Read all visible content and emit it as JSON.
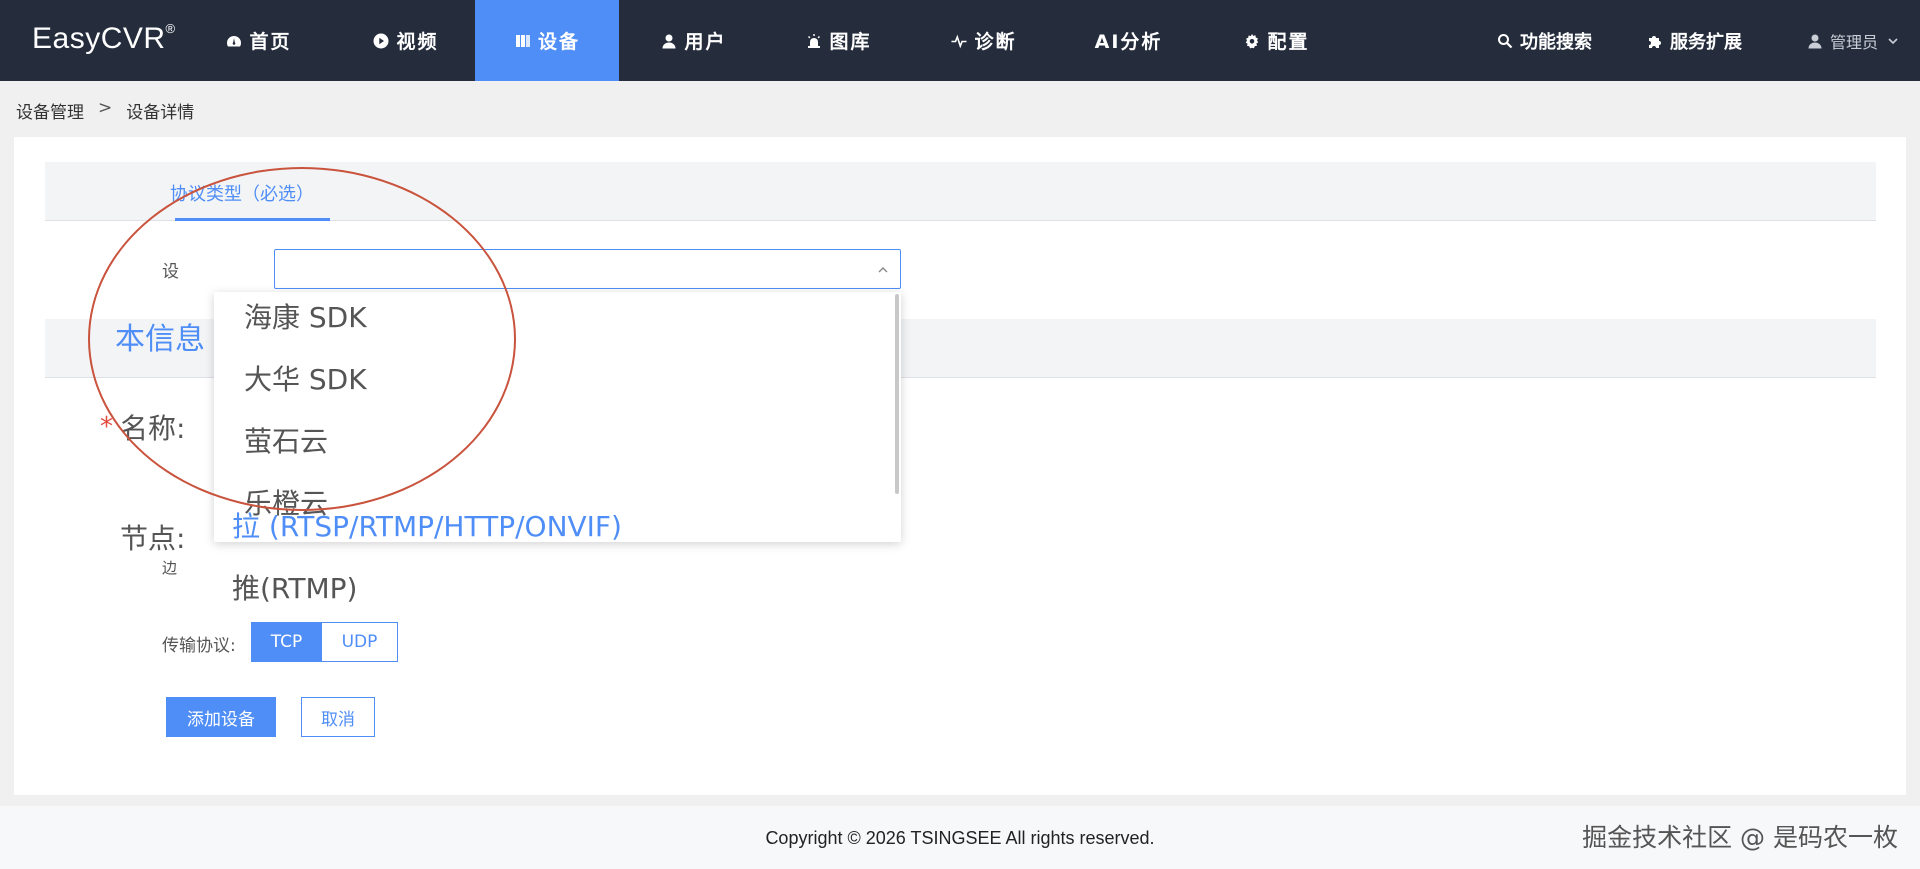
{
  "brand": {
    "name": "EasyCVR",
    "reg": "®"
  },
  "nav": [
    {
      "label": "首页",
      "icon": "dashboard-icon"
    },
    {
      "label": "视频",
      "icon": "play-circle-icon"
    },
    {
      "label": "设备",
      "icon": "device-grid-icon"
    },
    {
      "label": "用户",
      "icon": "user-icon"
    },
    {
      "label": "图库",
      "icon": "alarm-light-icon"
    },
    {
      "label": "诊断",
      "icon": "pulse-icon"
    },
    {
      "label": "AI分析",
      "icon": ""
    },
    {
      "label": "配置",
      "icon": "gear-icon"
    }
  ],
  "nav_right": [
    {
      "label": "功能搜索",
      "icon": "search-icon"
    },
    {
      "label": "服务扩展",
      "icon": "puzzle-icon"
    }
  ],
  "user": {
    "label": "管理员"
  },
  "breadcrumb": {
    "parent": "设备管理",
    "separator": ">",
    "current": "设备详情"
  },
  "form": {
    "section1_title": "协议类型（必选）",
    "access_label": "设",
    "section2_title": "本信息",
    "name_label": "名称:",
    "node_label": "节点:",
    "node_small_label": "边",
    "protocol_label": "传输协议:",
    "tcp": "TCP",
    "udp": "UDP",
    "add_button": "添加设备",
    "cancel_button": "取消"
  },
  "dropdown": {
    "options": [
      "海康 SDK",
      "大华 SDK",
      "萤石云",
      "乐橙云",
      "拉 (RTSP/RTMP/HTTP/ONVIF)",
      "推(RTMP)"
    ],
    "selected_index": 4
  },
  "footer": {
    "copyright": "Copyright © 2026 TSINGSEE All rights reserved.",
    "watermark": "掘金技术社区 @ 是码农一枚"
  },
  "colors": {
    "nav_bg": "#252d3d",
    "accent": "#4f8ef7",
    "required": "#e34b3f",
    "circle": "#c9533d"
  }
}
